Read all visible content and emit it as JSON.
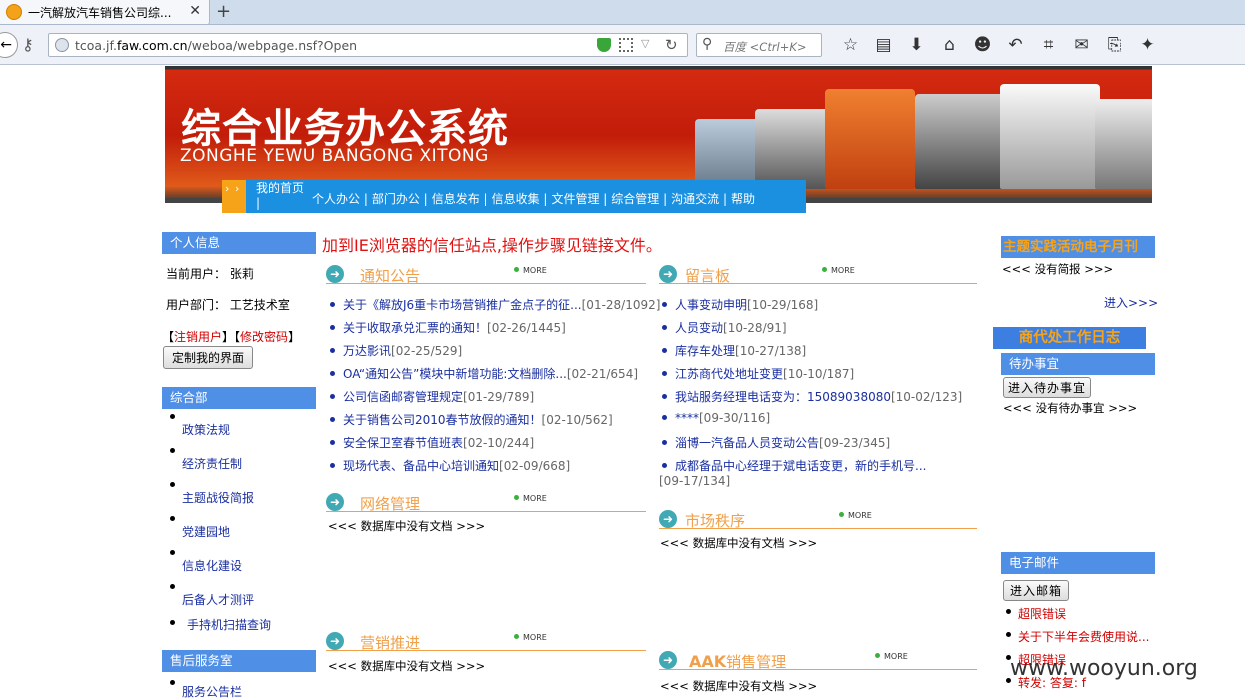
{
  "browser": {
    "tab_title": "一汽解放汽车销售公司综...",
    "url_prefix": "tcoa.jf.",
    "url_host": "faw.com.cn",
    "url_path": "/weboa/webpage.nsf?Open",
    "search_placeholder": "百度 <Ctrl+K>"
  },
  "banner": {
    "title_cn": "综合业务办公系统",
    "title_pinyin": "ZONGHE YEWU BANGONG XITONG"
  },
  "nav": {
    "home": "我的首页",
    "home_sep": "|",
    "items": [
      "个人办公 |",
      "部门办公 |",
      "信息发布 |",
      "信息收集 |",
      "文件管理 |",
      "综合管理 |",
      "沟通交流 |",
      "帮助"
    ]
  },
  "left": {
    "personal_head": "个人信息",
    "current_user": "当前用户： 张莉",
    "user_dept": "用户部门： 工艺技术室",
    "logout": "注销用户",
    "change_pwd": "修改密码",
    "logout_full": "【注销用户】【修改密码】",
    "customize": "定制我的界面",
    "dept_head": "综合部",
    "dept_links": [
      "政策法规",
      "经济责任制",
      "主题战役简报",
      "党建园地",
      "信息化建设",
      "后备人才测评",
      "手持机扫描查询"
    ],
    "service_head": "售后服务室",
    "service_links": [
      "服务公告栏"
    ]
  },
  "marquee": "加到IE浏览器的信任站点,操作步骤见链接文件。",
  "notice": {
    "title": "通知公告",
    "more": "MORE",
    "items": [
      {
        "text": "关于《解放J6重卡市场营销推广金点子的征...",
        "meta": "[01-28/1092]"
      },
      {
        "text": "关于收取承兑汇票的通知！",
        "meta": "[02-26/1445]"
      },
      {
        "text": "万达影讯",
        "meta": "[02-25/529]"
      },
      {
        "text": "OA“通知公告”模块中新增功能:文档删除...",
        "meta": "[02-21/654]"
      },
      {
        "text": "公司信函邮寄管理规定",
        "meta": "[01-29/789]"
      },
      {
        "text": "关于销售公司2010春节放假的通知！",
        "meta": "[02-10/562]"
      },
      {
        "text": "安全保卫室春节值班表",
        "meta": "[02-10/244]"
      },
      {
        "text": "现场代表、备品中心培训通知",
        "meta": "[02-09/668]"
      }
    ]
  },
  "network": {
    "title": "网络管理",
    "more": "MORE",
    "empty": "<<< 数据库中没有文档 >>>"
  },
  "marketing": {
    "title": "营销推进",
    "more": "MORE",
    "empty": "<<< 数据库中没有文档 >>>"
  },
  "board": {
    "title": "留言板",
    "more": "MORE",
    "items": [
      {
        "text": "人事变动申明",
        "meta": "[10-29/168]"
      },
      {
        "text": "人员变动",
        "meta": "[10-28/91]"
      },
      {
        "text": "库存车处理",
        "meta": "[10-27/138]"
      },
      {
        "text": "江苏商代处地址变更",
        "meta": "[10-10/187]"
      },
      {
        "text": "我站服务经理电话变为：15089038080",
        "meta": "[10-02/123]"
      },
      {
        "text": "****",
        "meta": "[09-30/116]"
      },
      {
        "text": "淄博一汽备品人员变动公告",
        "meta": "[09-23/345]"
      },
      {
        "text": "成都备品中心经理于斌电话变更，新的手机号...",
        "meta": "[09-17/134]"
      }
    ]
  },
  "market": {
    "title": "市场秩序",
    "more": "MORE",
    "empty": "<<< 数据库中没有文档 >>>"
  },
  "aak": {
    "title_prefix": "AAK",
    "title": "销售管理",
    "more": "MORE",
    "empty": "<<< 数据库中没有文档 >>>"
  },
  "right": {
    "monthly_title": "主题实践活动电子月刊",
    "no_brief": "<<< 没有简报 >>>",
    "enter": "进入>>>",
    "log_title": "商代处工作日志",
    "todo_head": "待办事宜",
    "todo_btn": "进入待办事宜",
    "no_todo": "<<< 没有待办事宜 >>>",
    "mail_head": "电子邮件",
    "mail_btn": "进入邮箱",
    "mail_items": [
      "超限错误",
      "关于下半年会费使用说...",
      "超限错误",
      "转发: 答复: f"
    ]
  },
  "watermark": "www.wooyun.org"
}
